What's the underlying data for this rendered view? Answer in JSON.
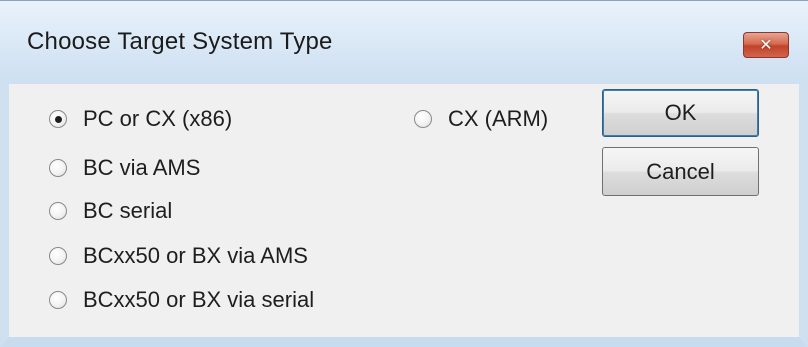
{
  "window": {
    "title": "Choose Target System Type",
    "close_glyph": "✕"
  },
  "options": [
    {
      "label": "PC or CX (x86)",
      "checked": true
    },
    {
      "label": "BC via AMS",
      "checked": false
    },
    {
      "label": "BC serial",
      "checked": false
    },
    {
      "label": "BCxx50 or BX via AMS",
      "checked": false
    },
    {
      "label": "BCxx50 or BX via serial",
      "checked": false
    },
    {
      "label": "CX (ARM)",
      "checked": false
    }
  ],
  "buttons": {
    "ok_label": "OK",
    "cancel_label": "Cancel"
  }
}
